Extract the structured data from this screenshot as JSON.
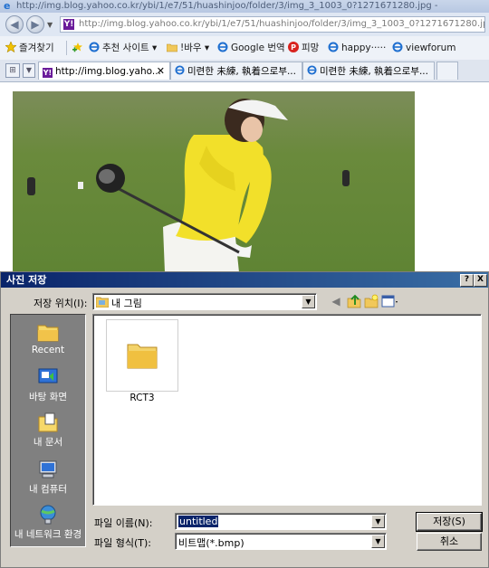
{
  "window_title": "http://img.blog.yahoo.co.kr/ybi/1/e7/51/huashinjoo/folder/3/img_3_1003_0?1271671280.jpg -",
  "address": {
    "url": "http://img.blog.yahoo.co.kr/ybi/1/e7/51/huashinjoo/folder/3/img_3_1003_0?1271671280.jpg"
  },
  "favorites_bar": {
    "favorites": "즐겨찾기",
    "recommended": "추천 사이트 ▾",
    "baru": "!바우 ▾",
    "google": "Google 번역",
    "pimang": "피망",
    "happy": "happy·····",
    "viewforum": "viewforum"
  },
  "tabs": [
    {
      "label": "http://img.blog.yaho..."
    },
    {
      "label": "미련한 未練, 執着으로부..."
    },
    {
      "label": "미련한 未練, 執着으로부..."
    }
  ],
  "dialog": {
    "title": "사진 저장",
    "help": "?",
    "close": "X",
    "save_in_label": "저장 위치(I):",
    "save_in_value": "내 그림",
    "places": [
      {
        "label": "Recent",
        "icon": "recent-folder-icon"
      },
      {
        "label": "바탕 화면",
        "icon": "desktop-icon"
      },
      {
        "label": "내 문서",
        "icon": "my-documents-icon"
      },
      {
        "label": "내 컴퓨터",
        "icon": "my-computer-icon"
      },
      {
        "label": "내 네트워크 환경",
        "icon": "network-places-icon"
      }
    ],
    "files": [
      {
        "name": "RCT3",
        "type": "folder"
      }
    ],
    "filename_label": "파일 이름(N):",
    "filename_value": "untitled",
    "filetype_label": "파일 형식(T):",
    "filetype_value": "비트맵(*.bmp)",
    "save_button": "저장(S)",
    "cancel_button": "취소"
  },
  "colors": {
    "dialog_title_start": "#0a246a",
    "dialog_title_end": "#3a6ea5",
    "dialog_face": "#d4d0c8"
  }
}
